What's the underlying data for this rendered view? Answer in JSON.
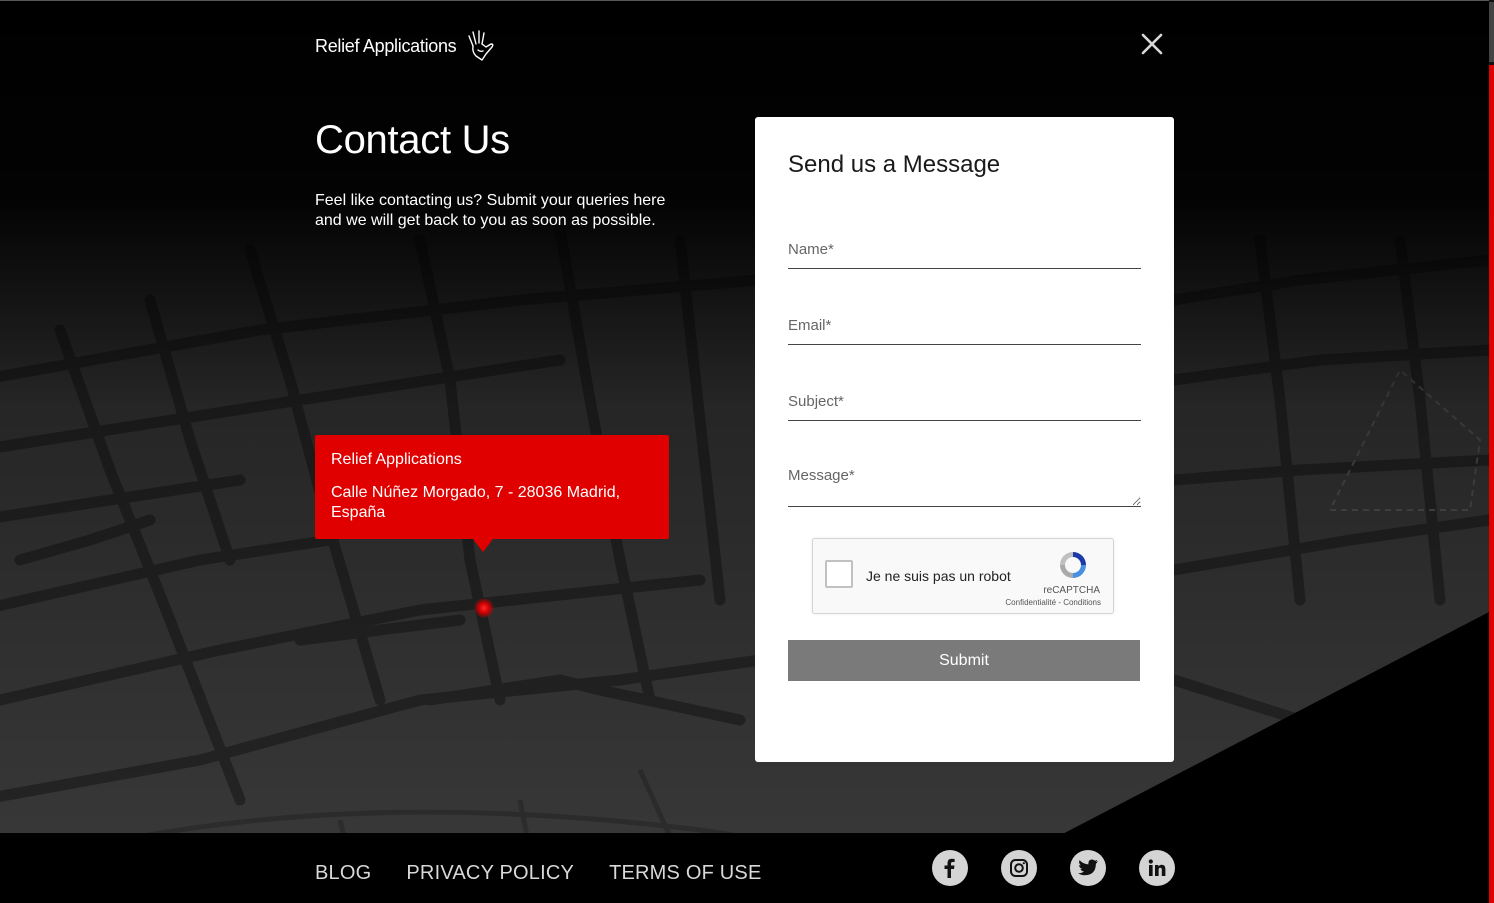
{
  "header": {
    "logo_text": "Relief Applications",
    "logo_icon": "hand-icon",
    "close_icon": "close-icon"
  },
  "intro": {
    "title": "Contact Us",
    "description": "Feel like contacting us? Submit your queries here and we will get back to you as soon as possible."
  },
  "location": {
    "name": "Relief Applications",
    "address": "Calle Núñez Morgado, 7 - 28036 Madrid, España"
  },
  "form": {
    "title": "Send us a Message",
    "name_placeholder": "Name*",
    "email_placeholder": "Email*",
    "subject_placeholder": "Subject*",
    "message_placeholder": "Message*",
    "recaptcha": {
      "label": "Je ne suis pas un robot",
      "brand": "reCAPTCHA",
      "links": "Confidentialité - Conditions"
    },
    "submit_label": "Submit"
  },
  "footer": {
    "links": [
      "BLOG",
      "PRIVACY POLICY",
      "TERMS OF USE"
    ],
    "socials": [
      "facebook-icon",
      "instagram-icon",
      "twitter-icon",
      "linkedin-icon"
    ]
  },
  "colors": {
    "accent": "#e00000",
    "background": "#000000",
    "submit_bg": "#7a7a7a",
    "card": "#ffffff"
  }
}
